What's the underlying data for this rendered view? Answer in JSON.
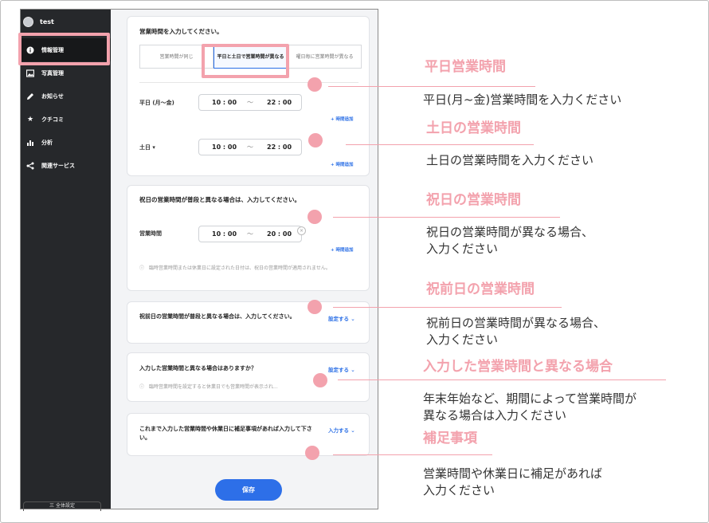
{
  "sidebar": {
    "user_name": "test",
    "items": [
      {
        "label": "情報管理",
        "icon": "info-icon"
      },
      {
        "label": "写真管理",
        "icon": "photo-icon"
      },
      {
        "label": "お知らせ",
        "icon": "pencil-icon"
      },
      {
        "label": "クチコミ",
        "icon": "star-icon"
      },
      {
        "label": "分析",
        "icon": "bar-chart-icon"
      },
      {
        "label": "関連サービス",
        "icon": "share-icon"
      }
    ],
    "footer_label": "三 全体設定"
  },
  "hours_card": {
    "title": "営業時間を入力してください。",
    "options": [
      "営業時間が同じ",
      "平日と土日で営業時間が異なる",
      "曜日毎に営業時間が異なる"
    ],
    "weekday_label": "平日 (月～金)",
    "weekday_open": "10 : 00",
    "weekday_sep": "～",
    "weekday_close": "22 : 00",
    "weekend_label": "土日 ▾",
    "weekend_open": "10 : 00",
    "weekend_sep": "～",
    "weekend_close": "22 : 00",
    "add_time_1": "+ 時間追加",
    "add_time_2": "+ 時間追加"
  },
  "holiday_card": {
    "title": "祝日の営業時間が普段と異なる場合は、入力してください。",
    "hours_label": "営業時間",
    "open": "10 : 00",
    "sep": "～",
    "close": "20 : 00",
    "remove": "×",
    "add_time": "+ 時間追加",
    "note": "ⓘ　臨時営業時間または休業日に設定された日付は、祝日の営業時間が適用されません。"
  },
  "pre_holiday_card": {
    "title": "祝前日の営業時間が普段と異なる場合は、入力してください。",
    "action": "設定する ⌄"
  },
  "special_card": {
    "title": "入力した営業時間と異なる場合はありますか？",
    "action": "設定する ⌄",
    "note": "ⓘ　臨時営業時間を設定すると休業日でも営業時間が表示され..."
  },
  "supplement_card": {
    "title": "これまで入力した営業時間や休業日に補足事項があれば入力して下さい。",
    "action": "入力する ⌄"
  },
  "save_label": "保存",
  "annotations": [
    {
      "title": "平日営業時間",
      "desc": "平日(月~金)営業時間を入力ください"
    },
    {
      "title": "土日の営業時間",
      "desc": "土日の営業時間を入力ください"
    },
    {
      "title": "祝日の営業時間",
      "desc": "祝日の営業時間が異なる場合、\n入力ください"
    },
    {
      "title": "祝前日の営業時間",
      "desc": "祝前日の営業時間が異なる場合、\n入力ください"
    },
    {
      "title": "入力した営業時間と異なる場合",
      "desc": "年末年始など、期間によって営業時間が\n異なる場合は入力ください"
    },
    {
      "title": "補足事項",
      "desc": "営業時間や休業日に補足があれば\n入力ください"
    }
  ],
  "colors": {
    "accent_blue": "#2d6fe8",
    "annotation_pink": "#f3a2ad",
    "sidebar_bg": "#26282b"
  }
}
